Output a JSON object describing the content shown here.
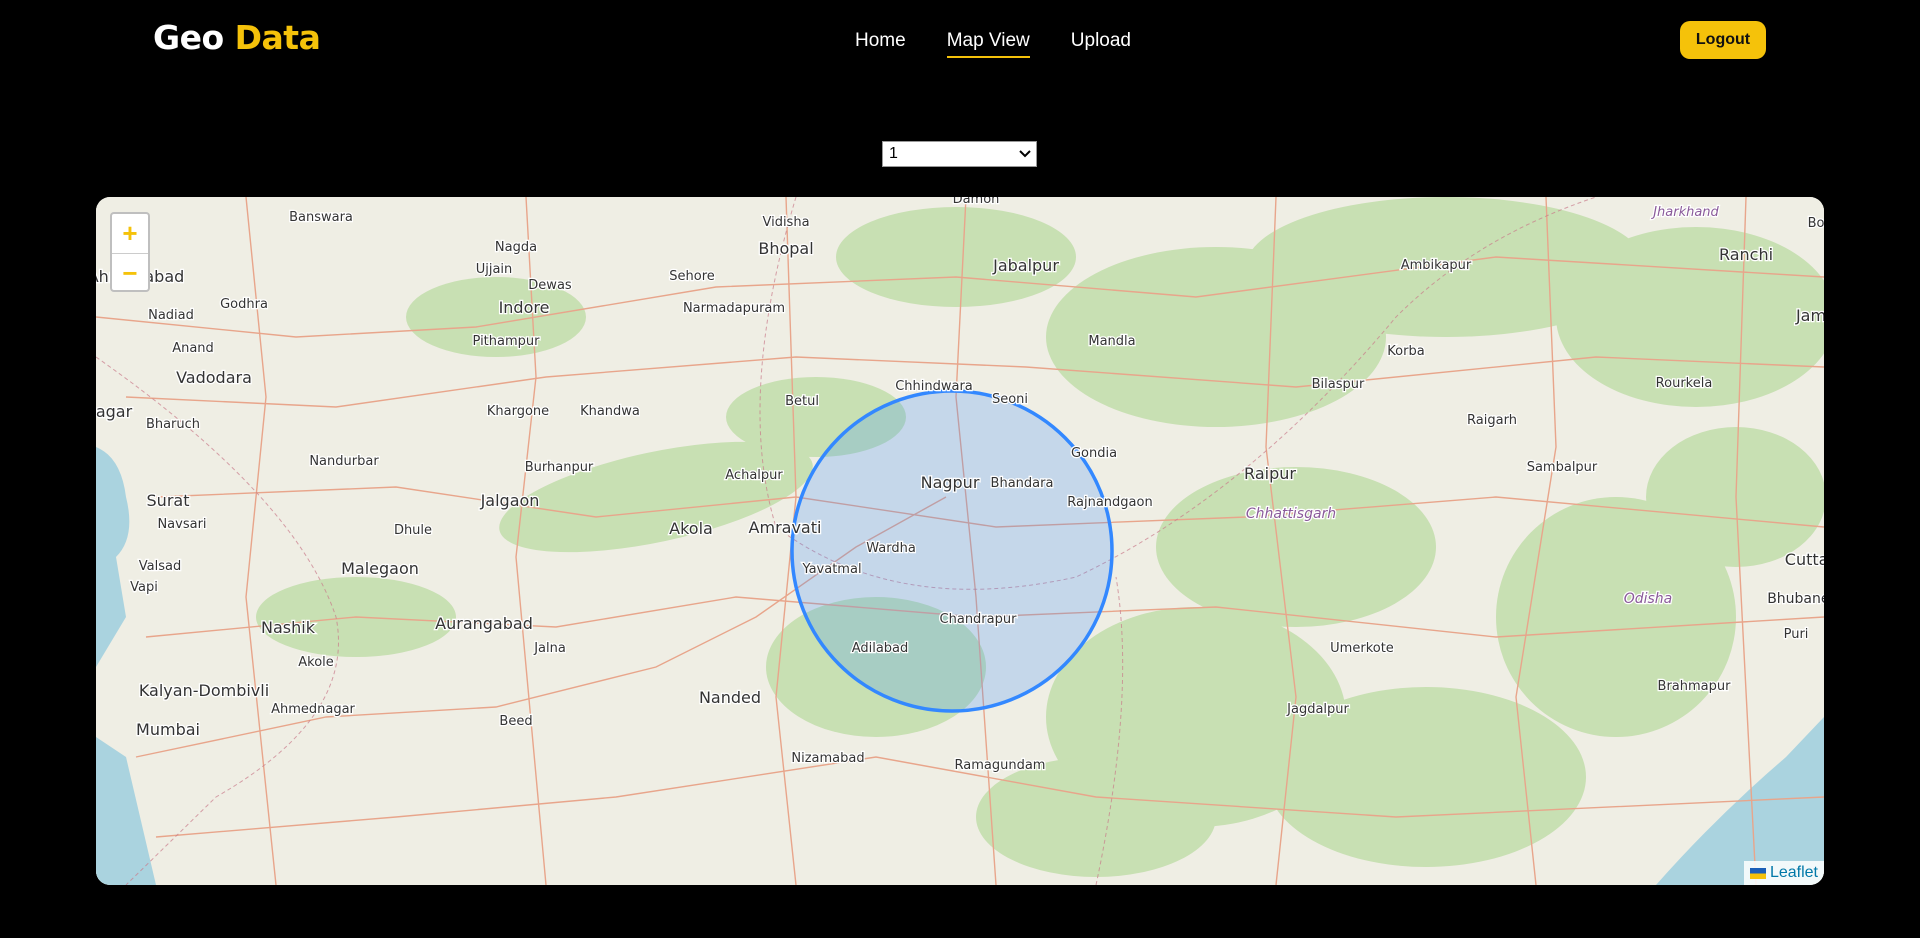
{
  "brand": {
    "part1": "Geo",
    "part2": "Data"
  },
  "nav": {
    "items": [
      {
        "label": "Home"
      },
      {
        "label": "Map View"
      },
      {
        "label": "Upload"
      }
    ]
  },
  "logout_label": "Logout",
  "select": {
    "value": "1"
  },
  "map": {
    "attribution": "Leaflet",
    "zoom_in": "+",
    "zoom_out": "−",
    "places": [
      {
        "name": "Damoh"
      },
      {
        "name": "Banswara"
      },
      {
        "name": "Vidisha"
      },
      {
        "name": "Jabalpur"
      },
      {
        "name": "Jharkhand"
      },
      {
        "name": "Nagda"
      },
      {
        "name": "Bhopal"
      },
      {
        "name": "Ujjain"
      },
      {
        "name": "Sehore"
      },
      {
        "name": "Ambikapur"
      },
      {
        "name": "Ranchi"
      },
      {
        "name": "Dewas"
      },
      {
        "name": "Godhra"
      },
      {
        "name": "Indore"
      },
      {
        "name": "Narmadapuram"
      },
      {
        "name": "Nadiad"
      },
      {
        "name": "Pithampur"
      },
      {
        "name": "Mandla"
      },
      {
        "name": "Anand"
      },
      {
        "name": "Korba"
      },
      {
        "name": "Vadodara"
      },
      {
        "name": "Chhindwara"
      },
      {
        "name": "Seoni"
      },
      {
        "name": "Bilaspur"
      },
      {
        "name": "Rourkela"
      },
      {
        "name": "Betul"
      },
      {
        "name": "Khargone"
      },
      {
        "name": "Khandwa"
      },
      {
        "name": "Bharuch"
      },
      {
        "name": "Raigarh"
      },
      {
        "name": "Gondia"
      },
      {
        "name": "Nandurbar"
      },
      {
        "name": "Sambalpur"
      },
      {
        "name": "Burhanpur"
      },
      {
        "name": "Achalpur"
      },
      {
        "name": "Nagpur"
      },
      {
        "name": "Bhandara"
      },
      {
        "name": "Raipur"
      },
      {
        "name": "Surat"
      },
      {
        "name": "Jalgaon"
      },
      {
        "name": "Rajnandgaon"
      },
      {
        "name": "Chhattisgarh"
      },
      {
        "name": "Navsari"
      },
      {
        "name": "Dhule"
      },
      {
        "name": "Akola"
      },
      {
        "name": "Amravati"
      },
      {
        "name": "Wardha"
      },
      {
        "name": "Valsad"
      },
      {
        "name": "Malegaon"
      },
      {
        "name": "Yavatmal"
      },
      {
        "name": "Cuttac"
      },
      {
        "name": "Vapi"
      },
      {
        "name": "Odisha"
      },
      {
        "name": "Bhubanes"
      },
      {
        "name": "Nashik"
      },
      {
        "name": "Aurangabad"
      },
      {
        "name": "Chandrapur"
      },
      {
        "name": "Puri"
      },
      {
        "name": "Jalna"
      },
      {
        "name": "Adilabad"
      },
      {
        "name": "Umerkote"
      },
      {
        "name": "Akole"
      },
      {
        "name": "Brahmapur"
      },
      {
        "name": "Kalyan-Dombivli"
      },
      {
        "name": "Nanded"
      },
      {
        "name": "Ahmednagar"
      },
      {
        "name": "Jagdalpur"
      },
      {
        "name": "Beed"
      },
      {
        "name": "Mumbai"
      },
      {
        "name": "Nizamabad"
      },
      {
        "name": "Ramagundam"
      },
      {
        "name": "Ahmedabad"
      },
      {
        "name": "Jam"
      },
      {
        "name": "Bo"
      },
      {
        "name": "Nagar"
      }
    ]
  }
}
